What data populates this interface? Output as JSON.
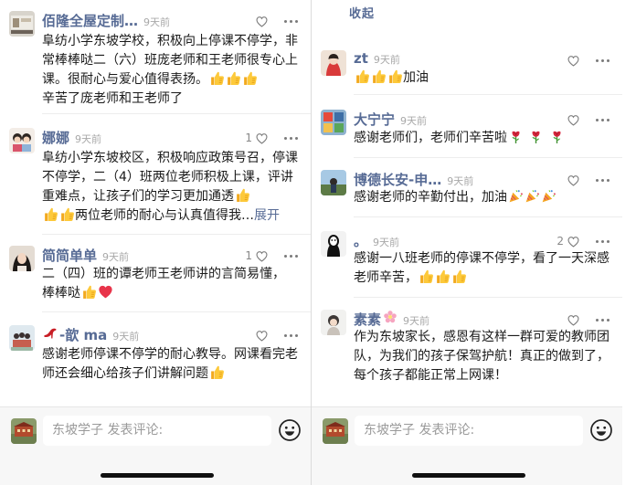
{
  "left": {
    "comments": [
      {
        "name": "佰隆全屋定制…",
        "time": "9天前",
        "likes": "",
        "text": "阜纺小学东坡学校，积极向上停课不停学，非常棒棒哒二（六）班庞老师和王老师很专心上课。很耐心与爱心值得表扬。",
        "tail": "辛苦了庞老师和王老师了"
      },
      {
        "name": "娜娜",
        "time": "9天前",
        "likes": "1",
        "text": "阜纺小学东坡校区，积极响应政策号召，停课不停学，二（4）班两位老师积极上课，评讲重难点，让孩子们的学习更加通透",
        "tail": "两位老师的耐心与认真值得我…",
        "expand": "展开"
      },
      {
        "name": "简简单单",
        "time": "9天前",
        "likes": "1",
        "text": "二（四）班的谭老师王老师讲的言简易懂，",
        "tail": "棒棒哒"
      },
      {
        "name": "-歆 ma",
        "time": "9天前",
        "likes": "",
        "text": "感谢老师停课不停学的耐心教导。网课看完老师还会细心给孩子们讲解问题"
      }
    ],
    "comment_placeholder": "东坡学子 发表评论:"
  },
  "right": {
    "collapse_label": "收起",
    "comments": [
      {
        "name": "zt",
        "time": "9天前",
        "likes": "",
        "text": "加油"
      },
      {
        "name": "大宁宁",
        "time": "9天前",
        "likes": "",
        "text": "感谢老师们，老师们辛苦啦"
      },
      {
        "name": "博德长安-申…",
        "time": "9天前",
        "likes": "",
        "text": "感谢老师的辛勤付出，加油"
      },
      {
        "name": "。",
        "time": "9天前",
        "likes": "2",
        "text": "感谢一八班老师的停课不停学，看了一天深感老师辛苦，"
      },
      {
        "name": "素素",
        "time": "9天前",
        "likes": "",
        "text": "作为东坡家长，感恩有这样一群可爱的教师团队，为我们的孩子保驾护航！真正的做到了，每个孩子都能正常上网课！"
      }
    ],
    "comment_placeholder": "东坡学子 发表评论:"
  },
  "icons": {
    "like": "heart-outline-icon",
    "more": "more-dots-icon",
    "emoji": "smiley-face-icon",
    "thumb": "thumbs-up-emoji",
    "rose": "rose-emoji",
    "party": "party-popper-emoji",
    "heart": "red-heart-emoji",
    "flower": "flower-emoji",
    "high_heel": "high-heel-emoji"
  },
  "colors": {
    "name": "#576b95",
    "time": "#a8a8a8",
    "text": "#1a1a1a",
    "bar": "#f7f7f7"
  }
}
